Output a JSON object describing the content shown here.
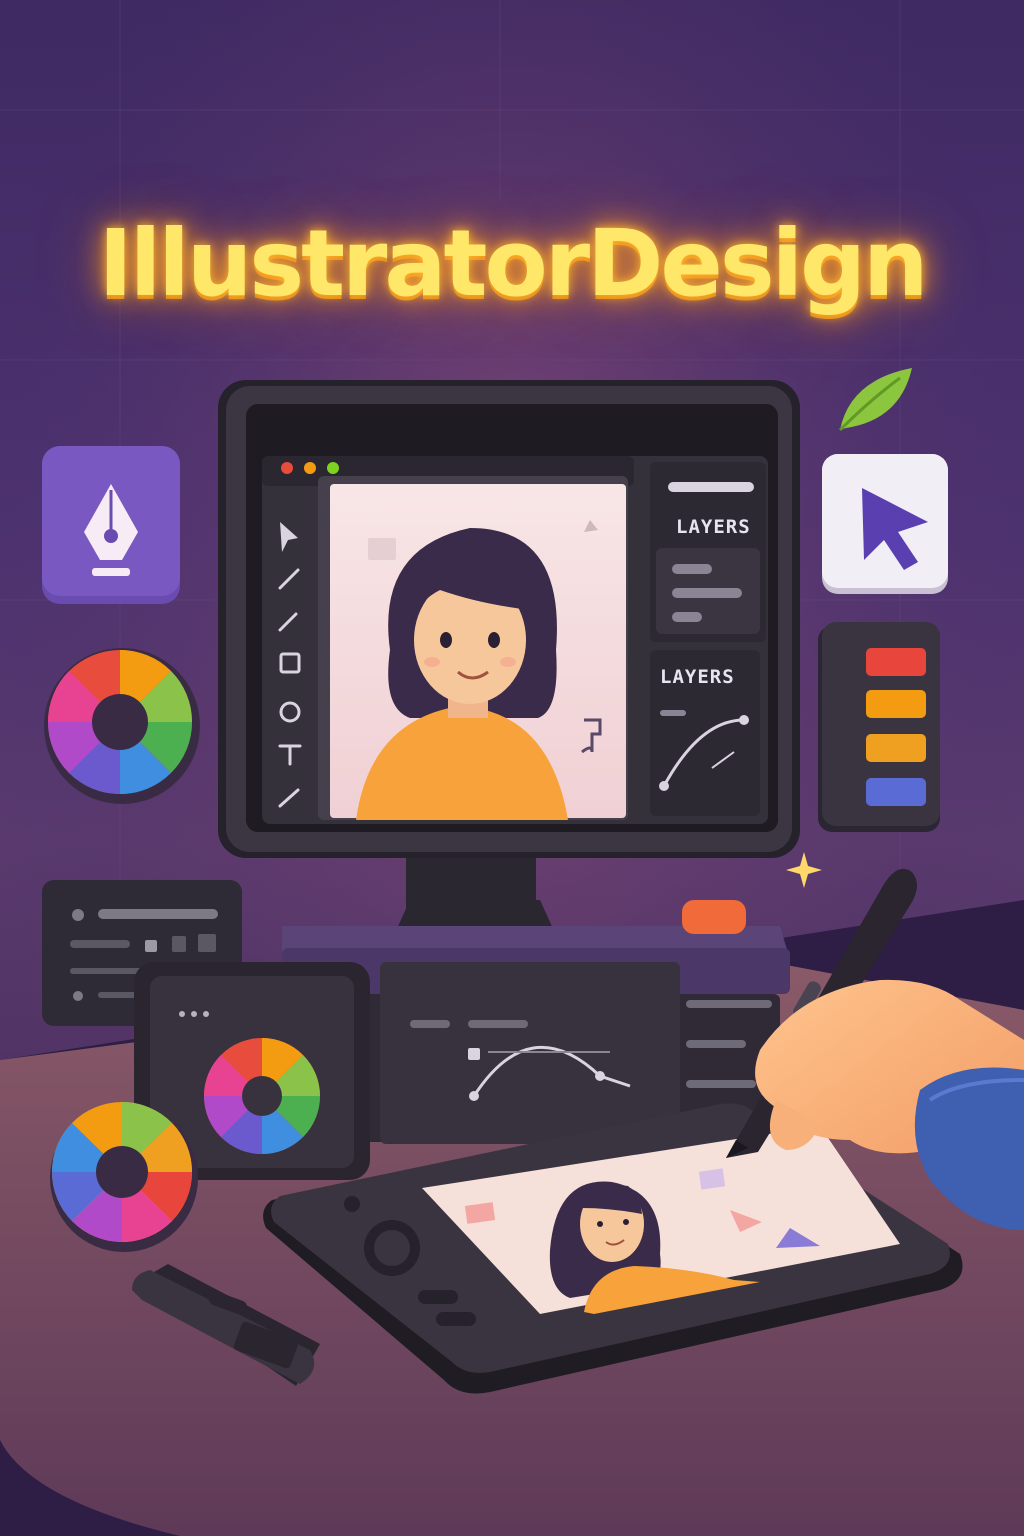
{
  "title": "IllustratorDesign",
  "monitor": {
    "window_dots": [
      "#e74c3c",
      "#f39c12",
      "#7ed321"
    ],
    "layers_panel_title_1": "LAYERS",
    "layers_panel_title_2": "LAYERS"
  },
  "tools": [
    "arrow-select",
    "pencil",
    "brush",
    "rectangle",
    "ellipse",
    "text",
    "line"
  ],
  "floating_icons": [
    "pen-tool-icon",
    "cursor-arrow-icon",
    "leaf-icon",
    "color-wheel-icon",
    "swatches-icon"
  ],
  "swatches": [
    "#e8453c",
    "#f39c12",
    "#f0a020",
    "#5b6bd6"
  ],
  "colors": {
    "title_glow": "#ffe76a",
    "accent_orange": "#f7a23a",
    "panel_dark": "#2f2b33",
    "icon_purple": "#6b4ab8"
  }
}
